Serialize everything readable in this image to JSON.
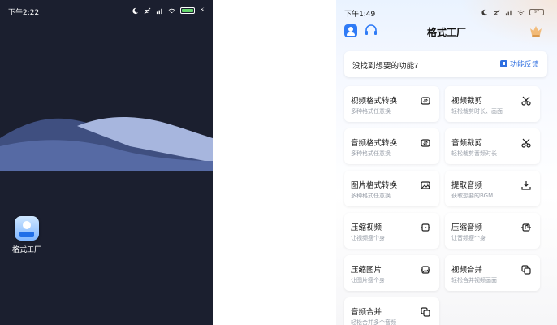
{
  "left_phone": {
    "status_time": "下午2:22",
    "app_label": "格式工厂"
  },
  "right_phone": {
    "status_time": "下午1:49",
    "battery_level": "97",
    "title": "格式工厂",
    "feedback": {
      "question": "没找到想要的功能?",
      "link_label": "功能反馈"
    },
    "tools": [
      {
        "name": "视频格式转换",
        "desc": "多种格式任意换",
        "icon": "convert-icon"
      },
      {
        "name": "视频裁剪",
        "desc": "轻松裁剪时长、画面",
        "icon": "scissors-icon"
      },
      {
        "name": "音频格式转换",
        "desc": "多种格式任意换",
        "icon": "convert-icon"
      },
      {
        "name": "音频裁剪",
        "desc": "轻松裁剪音频时长",
        "icon": "scissors-icon"
      },
      {
        "name": "图片格式转换",
        "desc": "多种格式任意换",
        "icon": "image-convert-icon"
      },
      {
        "name": "提取音频",
        "desc": "获取想要的BGM",
        "icon": "extract-icon"
      },
      {
        "name": "压缩视频",
        "desc": "让视频瘦个身",
        "icon": "compress-video-icon"
      },
      {
        "name": "压缩音频",
        "desc": "让音频瘦个身",
        "icon": "compress-audio-icon"
      },
      {
        "name": "压缩图片",
        "desc": "让图片瘦个身",
        "icon": "compress-image-icon"
      },
      {
        "name": "视频合并",
        "desc": "轻松合并视频画面",
        "icon": "merge-icon"
      },
      {
        "name": "音频合并",
        "desc": "轻松合并多个音频",
        "icon": "merge-icon"
      }
    ]
  },
  "colors": {
    "home_bg": "#1b1f2f",
    "accent": "#2f6fe0"
  }
}
